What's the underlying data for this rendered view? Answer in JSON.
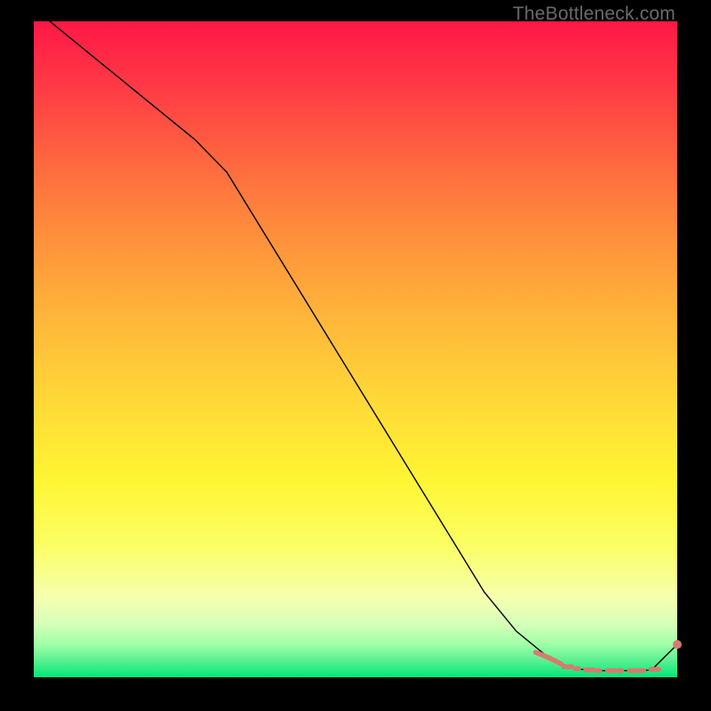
{
  "watermark": "TheBottleneck.com",
  "chart_data": {
    "type": "line",
    "title": "",
    "xlabel": "",
    "ylabel": "",
    "xlim": [
      0,
      100
    ],
    "ylim": [
      0,
      100
    ],
    "series": [
      {
        "name": "curve",
        "style": "solid-black",
        "x": [
          0,
          5,
          10,
          15,
          20,
          25,
          30,
          35,
          40,
          45,
          50,
          55,
          60,
          65,
          70,
          75,
          80,
          82,
          85,
          88,
          90,
          93,
          96,
          100
        ],
        "y": [
          102,
          98,
          94,
          90,
          86,
          82,
          77,
          69,
          61,
          53,
          45,
          37,
          29,
          21,
          13,
          7,
          3,
          2,
          1.2,
          1,
          1,
          1,
          1.1,
          5
        ]
      },
      {
        "name": "highlight-segment",
        "style": "thick-salmon",
        "x": [
          78,
          80,
          82
        ],
        "y": [
          3.8,
          3.0,
          2.0
        ]
      },
      {
        "name": "highlight-dashes",
        "style": "dash-salmon",
        "points": [
          {
            "x": 83.0,
            "y": 1.6
          },
          {
            "x": 84.4,
            "y": 1.3
          },
          {
            "x": 86.4,
            "y": 1.1
          },
          {
            "x": 87.7,
            "y": 1.0
          },
          {
            "x": 89.8,
            "y": 1.0
          },
          {
            "x": 91.1,
            "y": 1.0
          },
          {
            "x": 93.2,
            "y": 1.0
          },
          {
            "x": 94.5,
            "y": 1.0
          },
          {
            "x": 96.5,
            "y": 1.2
          }
        ]
      },
      {
        "name": "end-dot",
        "style": "dot-salmon",
        "x": [
          100
        ],
        "y": [
          5
        ]
      }
    ],
    "background": "red-yellow-green vertical gradient",
    "frame": "black"
  }
}
